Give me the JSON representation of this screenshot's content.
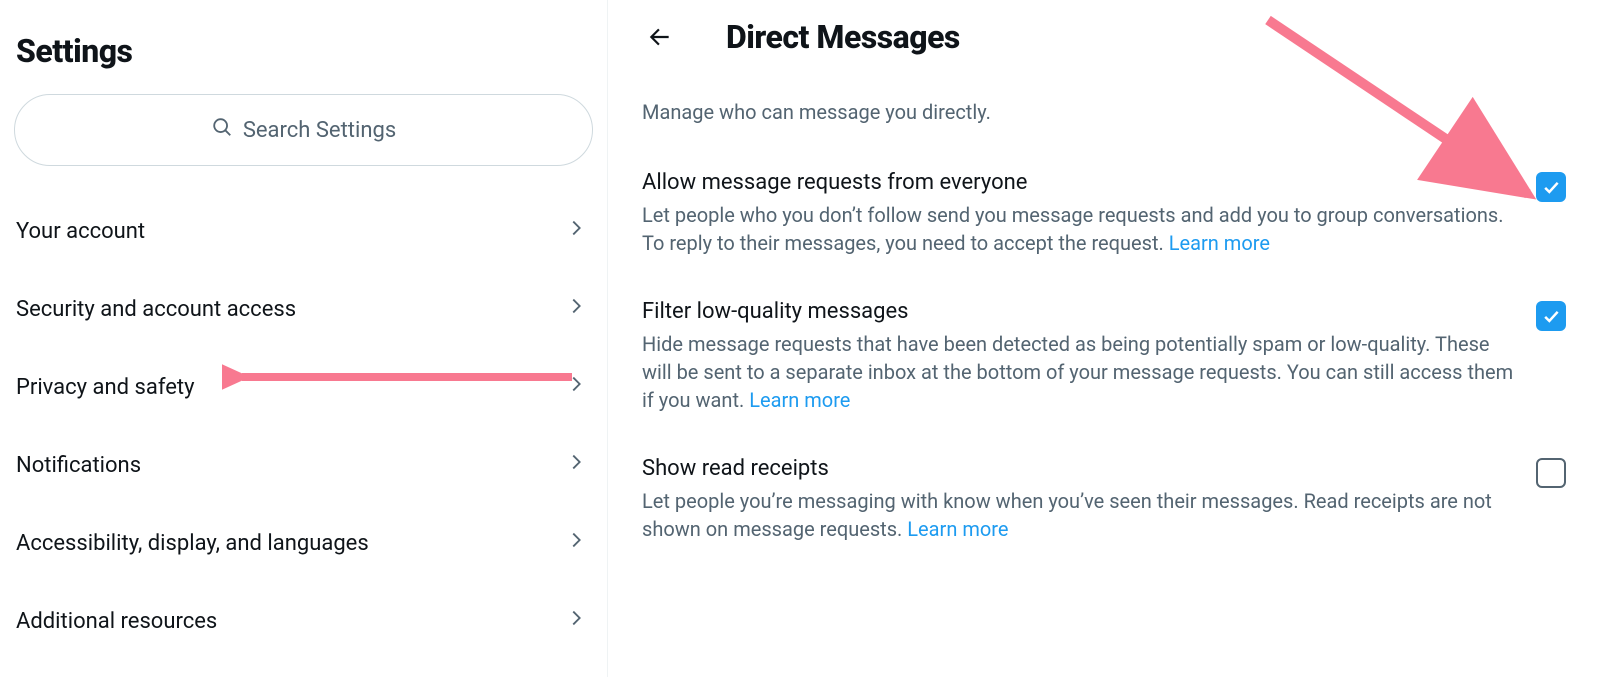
{
  "left": {
    "title": "Settings",
    "search_placeholder": "Search Settings",
    "items": [
      {
        "label": "Your account"
      },
      {
        "label": "Security and account access"
      },
      {
        "label": "Privacy and safety"
      },
      {
        "label": "Notifications"
      },
      {
        "label": "Accessibility, display, and languages"
      },
      {
        "label": "Additional resources"
      }
    ]
  },
  "right": {
    "title": "Direct Messages",
    "subtitle": "Manage who can message you directly.",
    "options": [
      {
        "title": "Allow message requests from everyone",
        "desc": "Let people who you don’t follow send you message requests and add you to group conversations. To reply to their messages, you need to accept the request. ",
        "learn": "Learn more",
        "checked": true
      },
      {
        "title": "Filter low-quality messages",
        "desc": "Hide message requests that have been detected as being potentially spam or low-quality. These will be sent to a separate inbox at the bottom of your message requests. You can still access them if you want. ",
        "learn": "Learn more",
        "checked": true
      },
      {
        "title": "Show read receipts",
        "desc": "Let people you’re messaging with know when you’ve seen their messages. Read receipts are not shown on message requests. ",
        "learn": "Learn more",
        "checked": false
      }
    ]
  }
}
